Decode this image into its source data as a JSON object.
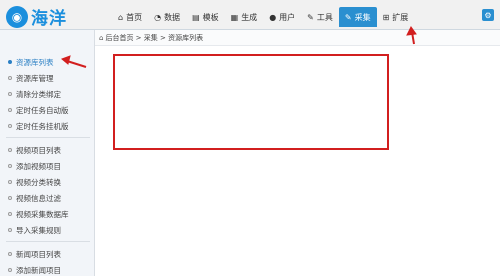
{
  "logo": {
    "text": "海洋",
    "icon": "globe-icon"
  },
  "nav": [
    {
      "icon": "home-icon",
      "glyph": "⌂",
      "label": "首页"
    },
    {
      "icon": "gauge-icon",
      "glyph": "◔",
      "label": "数据"
    },
    {
      "icon": "book-icon",
      "glyph": "▤",
      "label": "模板"
    },
    {
      "icon": "file-icon",
      "glyph": "▦",
      "label": "生成"
    },
    {
      "icon": "user-icon",
      "glyph": "●",
      "label": "用户"
    },
    {
      "icon": "wrench-icon",
      "glyph": "✎",
      "label": "工具"
    },
    {
      "icon": "edit-icon",
      "glyph": "✎",
      "label": "采集",
      "active": true
    },
    {
      "icon": "sitemap-icon",
      "glyph": "⊞",
      "label": "扩展"
    }
  ],
  "settings_icon": "gear-icon",
  "sidebar": {
    "items": [
      {
        "label": "资源库列表",
        "active": true
      },
      {
        "label": "资源库管理"
      },
      {
        "label": "清除分类绑定"
      },
      {
        "label": "定时任务自动版"
      },
      {
        "label": "定时任务挂机版"
      },
      {
        "label": "视频项目列表"
      },
      {
        "label": "添加视频项目"
      },
      {
        "label": "视频分类转换"
      },
      {
        "label": "视频信息过滤"
      },
      {
        "label": "视频采集数据库"
      },
      {
        "label": "导入采集规则"
      },
      {
        "label": "新闻项目列表"
      },
      {
        "label": "添加新闻项目"
      }
    ]
  },
  "breadcrumb": {
    "text": "后台首页 > 采集 > 资源库列表"
  },
  "accent_color": "#2a8fd0",
  "annotation_color": "#d21f1f"
}
